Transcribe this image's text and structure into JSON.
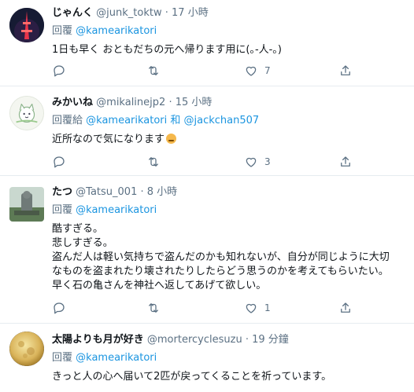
{
  "tweets": [
    {
      "name": "じゃんく",
      "handle": "@junk_toktw",
      "time": "17 小時",
      "reply_prefix": "回覆 ",
      "reply_to": [
        "@kamearikatori"
      ],
      "body": "1日も早く おともだちの元へ帰ります用に(｡-人-｡)",
      "replies": "",
      "retweets": "",
      "likes": "7",
      "avatar": "tower-night"
    },
    {
      "name": "みかいね",
      "handle": "@mikalinejp2",
      "time": "15 小時",
      "reply_prefix": "回覆給 ",
      "reply_to": [
        "@kamearikatori",
        "@jackchan507"
      ],
      "reply_joiner": " 和 ",
      "body": "近所なので気になります",
      "body_emoji": "worried-face",
      "replies": "",
      "retweets": "",
      "likes": "3",
      "avatar": "cat-illustration"
    },
    {
      "name": "たつ",
      "handle": "@Tatsu_001",
      "time": "8 小時",
      "reply_prefix": "回覆 ",
      "reply_to": [
        "@kamearikatori"
      ],
      "body": "酷すぎる。\n悲しすぎる。\n盗んだ人は軽い気持ちで盗んだのかも知れないが、自分が同じように大切\nなものを盗まれたり壊されたりしたらどう思うのかを考えてもらいたい。\n早く石の亀さんを神社へ返してあげて欲しい。",
      "replies": "",
      "retweets": "",
      "likes": "1",
      "avatar": "statue-photo"
    },
    {
      "name": "太陽よりも月が好き",
      "handle": "@mortercyclesuzu",
      "time": "19 分鐘",
      "reply_prefix": "回覆 ",
      "reply_to": [
        "@kamearikatori"
      ],
      "body": "きっと人の心へ届いて2匹が戻ってくることを祈っています。",
      "replies": "",
      "retweets": "",
      "likes": "",
      "avatar": "full-moon"
    }
  ],
  "colors": {
    "link": "#1b95e0",
    "muted": "#5b7083",
    "text": "#0f1419",
    "divider": "#e6ecf0"
  }
}
